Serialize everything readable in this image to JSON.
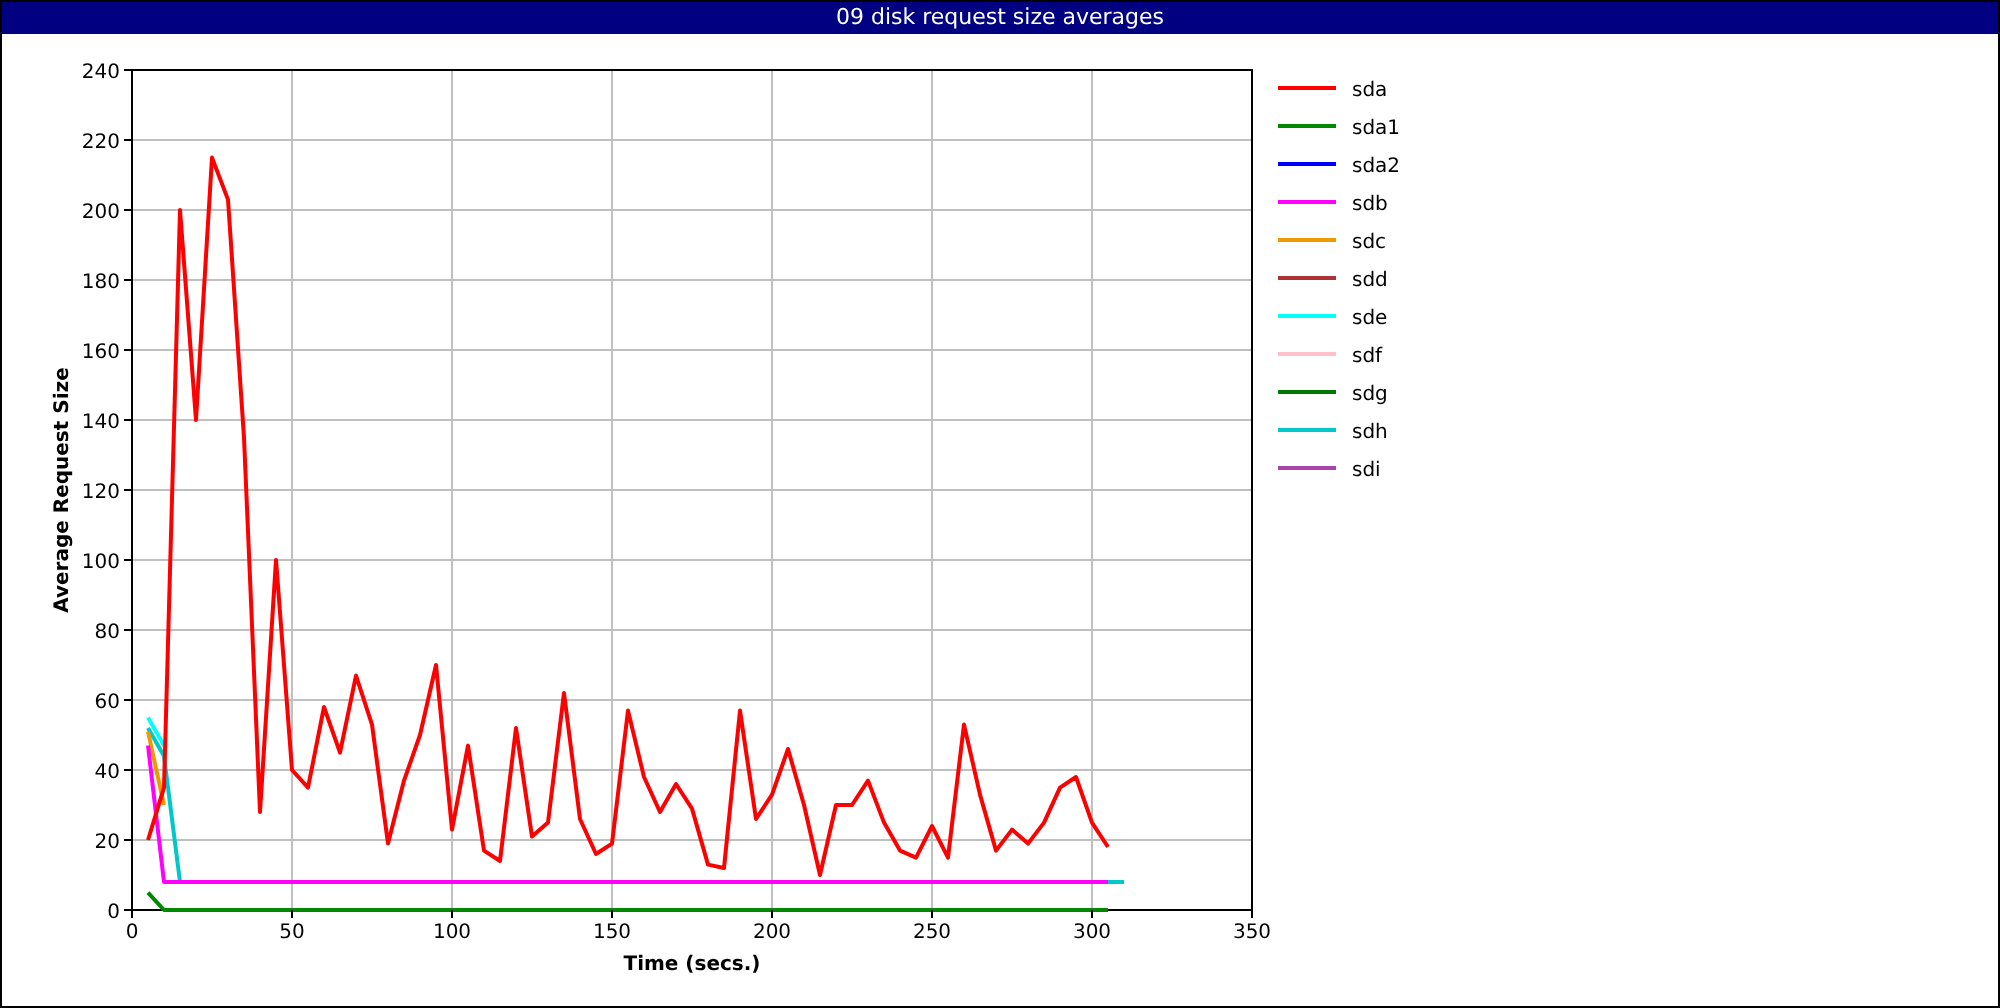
{
  "window": {
    "title": "09 disk request size averages"
  },
  "chart": {
    "chart_data": {
      "type": "line",
      "xlabel": "Time (secs.)",
      "ylabel": "Average Request Size",
      "grid": true,
      "legend": true,
      "x": [
        5,
        10,
        15,
        20,
        25,
        30,
        35,
        40,
        45,
        50,
        55,
        60,
        65,
        70,
        75,
        80,
        85,
        90,
        95,
        100,
        105,
        110,
        115,
        120,
        125,
        130,
        135,
        140,
        145,
        150,
        155,
        160,
        165,
        170,
        175,
        180,
        185,
        190,
        195,
        200,
        205,
        210,
        215,
        220,
        225,
        230,
        235,
        240,
        245,
        250,
        255,
        260,
        265,
        270,
        275,
        280,
        285,
        290,
        295,
        300,
        305,
        310
      ],
      "xlim": [
        0,
        350
      ],
      "ylim": [
        0,
        240
      ],
      "xticks": [
        0,
        50,
        100,
        150,
        200,
        250,
        300,
        350
      ],
      "yticks": [
        0,
        20,
        40,
        60,
        80,
        100,
        120,
        140,
        160,
        180,
        200,
        220,
        240
      ],
      "series": [
        {
          "name": "sda",
          "color": "#ff0000",
          "values": [
            20,
            35,
            200,
            140,
            215,
            203,
            135,
            28,
            100,
            40,
            35,
            58,
            45,
            67,
            53,
            19,
            37,
            50,
            70,
            23,
            47,
            17,
            14,
            52,
            21,
            25,
            62,
            26,
            16,
            19,
            57,
            38,
            28,
            36,
            29,
            13,
            12,
            57,
            26,
            33,
            46,
            30,
            10,
            30,
            30,
            37,
            25,
            17,
            15,
            24,
            15,
            53,
            33,
            17,
            23,
            19,
            25,
            35,
            38,
            25,
            18,
            null
          ]
        },
        {
          "name": "sda1",
          "color": "#008800",
          "values": [
            5,
            0,
            0,
            0,
            0,
            0,
            0,
            0,
            0,
            0,
            0,
            0,
            0,
            0,
            0,
            0,
            0,
            0,
            0,
            0,
            0,
            0,
            0,
            0,
            0,
            0,
            0,
            0,
            0,
            0,
            0,
            0,
            0,
            0,
            0,
            0,
            0,
            0,
            0,
            0,
            0,
            0,
            0,
            0,
            0,
            0,
            0,
            0,
            0,
            0,
            0,
            0,
            0,
            0,
            0,
            0,
            0,
            0,
            0,
            0,
            0,
            null
          ]
        },
        {
          "name": "sda2",
          "color": "#0000ff",
          "values": [
            null,
            null,
            null,
            null,
            null,
            null,
            null,
            null,
            null,
            null,
            null,
            null,
            null,
            null,
            null,
            null,
            null,
            null,
            null,
            null,
            null,
            null,
            null,
            null,
            null,
            null,
            null,
            null,
            null,
            null,
            null,
            null,
            null,
            null,
            null,
            null,
            null,
            null,
            null,
            null,
            null,
            null,
            null,
            null,
            null,
            null,
            null,
            null,
            null,
            null,
            null,
            null,
            null,
            null,
            null,
            null,
            null,
            null,
            null,
            null,
            null,
            null
          ]
        },
        {
          "name": "sdb",
          "color": "#ff00ff",
          "values": [
            47,
            8,
            8,
            8,
            8,
            8,
            8,
            8,
            8,
            8,
            8,
            8,
            8,
            8,
            8,
            8,
            8,
            8,
            8,
            8,
            8,
            8,
            8,
            8,
            8,
            8,
            8,
            8,
            8,
            8,
            8,
            8,
            8,
            8,
            8,
            8,
            8,
            8,
            8,
            8,
            8,
            8,
            8,
            8,
            8,
            8,
            8,
            8,
            8,
            8,
            8,
            8,
            8,
            8,
            8,
            8,
            8,
            8,
            8,
            8,
            8,
            null
          ]
        },
        {
          "name": "sdc",
          "color": "#ee9900",
          "values": [
            51,
            30,
            null,
            null,
            null,
            null,
            null,
            null,
            null,
            null,
            null,
            null,
            null,
            null,
            null,
            null,
            null,
            null,
            null,
            null,
            null,
            null,
            null,
            null,
            null,
            null,
            null,
            null,
            null,
            null,
            null,
            null,
            null,
            null,
            null,
            null,
            null,
            null,
            null,
            null,
            null,
            null,
            null,
            null,
            null,
            null,
            null,
            null,
            null,
            null,
            null,
            null,
            null,
            null,
            null,
            null,
            null,
            null,
            null,
            null,
            null,
            null
          ]
        },
        {
          "name": "sdd",
          "color": "#aa3333",
          "values": [
            null,
            null,
            null,
            null,
            null,
            null,
            null,
            null,
            null,
            null,
            null,
            null,
            null,
            null,
            null,
            null,
            null,
            null,
            null,
            null,
            null,
            null,
            null,
            null,
            null,
            null,
            null,
            null,
            null,
            null,
            null,
            null,
            null,
            null,
            null,
            null,
            null,
            null,
            null,
            null,
            null,
            null,
            null,
            null,
            null,
            null,
            null,
            null,
            null,
            null,
            null,
            null,
            null,
            null,
            null,
            null,
            null,
            null,
            null,
            null,
            null,
            null
          ]
        },
        {
          "name": "sde",
          "color": "#00ffff",
          "values": [
            55,
            47,
            null,
            null,
            null,
            null,
            null,
            null,
            null,
            null,
            null,
            null,
            null,
            null,
            null,
            null,
            null,
            null,
            null,
            null,
            null,
            null,
            null,
            null,
            null,
            null,
            null,
            null,
            null,
            null,
            null,
            null,
            null,
            null,
            null,
            null,
            null,
            null,
            null,
            null,
            null,
            null,
            null,
            null,
            null,
            null,
            null,
            null,
            null,
            null,
            null,
            null,
            null,
            null,
            null,
            null,
            null,
            null,
            null,
            null,
            null,
            null
          ]
        },
        {
          "name": "sdf",
          "color": "#ffc0cb",
          "values": [
            null,
            null,
            null,
            null,
            null,
            null,
            null,
            null,
            null,
            null,
            null,
            null,
            null,
            null,
            null,
            null,
            null,
            null,
            null,
            null,
            null,
            null,
            null,
            null,
            null,
            null,
            null,
            null,
            null,
            null,
            null,
            null,
            null,
            null,
            null,
            null,
            null,
            null,
            null,
            null,
            null,
            null,
            null,
            null,
            null,
            null,
            null,
            null,
            null,
            null,
            null,
            null,
            null,
            null,
            null,
            null,
            null,
            null,
            null,
            null,
            null,
            null
          ]
        },
        {
          "name": "sdg",
          "color": "#007700",
          "values": [
            null,
            null,
            null,
            null,
            null,
            null,
            null,
            null,
            null,
            null,
            null,
            null,
            null,
            null,
            null,
            null,
            null,
            null,
            null,
            null,
            null,
            null,
            null,
            null,
            null,
            null,
            null,
            null,
            null,
            null,
            null,
            null,
            null,
            null,
            null,
            null,
            null,
            null,
            null,
            null,
            null,
            null,
            null,
            null,
            null,
            null,
            null,
            null,
            null,
            null,
            null,
            null,
            null,
            null,
            null,
            null,
            null,
            null,
            null,
            null,
            null,
            null
          ]
        },
        {
          "name": "sdh",
          "color": "#00c8c8",
          "values": [
            52,
            44,
            8,
            null,
            null,
            null,
            null,
            null,
            null,
            null,
            null,
            null,
            null,
            null,
            null,
            null,
            null,
            null,
            null,
            null,
            null,
            null,
            null,
            null,
            null,
            null,
            null,
            null,
            null,
            null,
            null,
            null,
            null,
            null,
            null,
            null,
            null,
            null,
            null,
            null,
            null,
            null,
            null,
            null,
            null,
            null,
            null,
            null,
            null,
            null,
            null,
            null,
            null,
            null,
            null,
            null,
            null,
            null,
            null,
            null,
            8,
            8
          ]
        },
        {
          "name": "sdi",
          "color": "#aa44aa",
          "values": [
            null,
            null,
            null,
            null,
            null,
            null,
            null,
            null,
            null,
            null,
            null,
            null,
            null,
            null,
            null,
            null,
            null,
            null,
            null,
            null,
            null,
            null,
            null,
            null,
            null,
            null,
            null,
            null,
            null,
            null,
            null,
            null,
            null,
            null,
            null,
            null,
            null,
            null,
            null,
            null,
            null,
            null,
            null,
            null,
            null,
            null,
            null,
            null,
            null,
            null,
            null,
            null,
            null,
            null,
            null,
            null,
            null,
            null,
            null,
            null,
            null,
            null
          ]
        }
      ]
    }
  }
}
